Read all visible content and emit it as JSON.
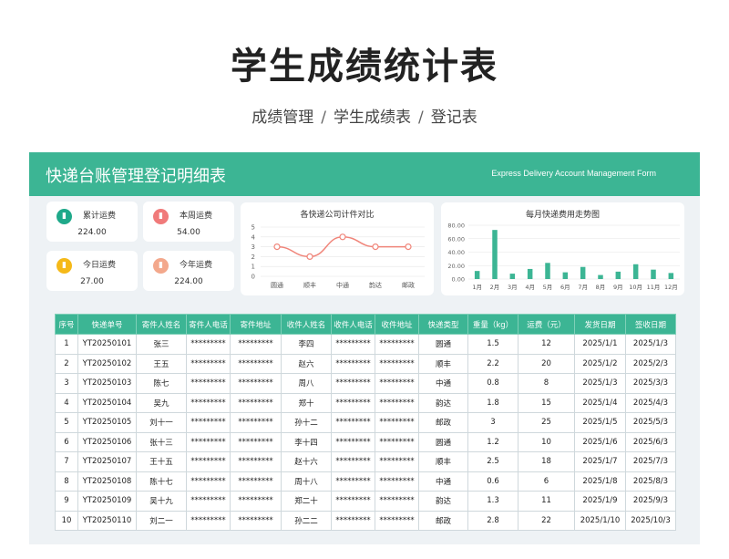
{
  "page": {
    "title": "学生成绩统计表",
    "breadcrumb": [
      "成绩管理",
      "学生成绩表",
      "登记表"
    ],
    "separator": "/"
  },
  "panel": {
    "title": "快递台账管理登记明细表",
    "subtitle": "Express Delivery Account Management Form"
  },
  "stats": [
    {
      "label": "累计运费",
      "value": "224.00",
      "icon": "chart-icon",
      "color": "#1fa98a"
    },
    {
      "label": "本周运费",
      "value": "54.00",
      "icon": "chart-icon",
      "color": "#f07a7a"
    },
    {
      "label": "今日运费",
      "value": "27.00",
      "icon": "chart-icon",
      "color": "#f5b919"
    },
    {
      "label": "今年运费",
      "value": "224.00",
      "icon": "chart-icon",
      "color": "#f3a88c"
    }
  ],
  "chart_data": [
    {
      "type": "line",
      "title": "各快递公司计件对比",
      "categories": [
        "圆通",
        "顺丰",
        "中通",
        "韵达",
        "邮政"
      ],
      "values": [
        3,
        2,
        4,
        3,
        3
      ],
      "ylim": [
        0,
        5
      ],
      "yticks": [
        "0",
        "1",
        "2",
        "3",
        "4",
        "5"
      ],
      "color": "#f0857a"
    },
    {
      "type": "bar",
      "title": "每月快递费用走势图",
      "categories": [
        "1月",
        "2月",
        "3月",
        "4月",
        "5月",
        "6月",
        "7月",
        "8月",
        "9月",
        "10月",
        "11月",
        "12月"
      ],
      "values": [
        12,
        73,
        8,
        15,
        24,
        10,
        18,
        6,
        11,
        22,
        14,
        9
      ],
      "ylim": [
        0,
        80
      ],
      "yticks": [
        "0.00",
        "20.00",
        "40.00",
        "60.00",
        "80.00"
      ],
      "color": "#3cb594"
    }
  ],
  "table": {
    "headers": [
      "序号",
      "快递单号",
      "寄件人姓名",
      "寄件人电话",
      "寄件地址",
      "收件人姓名",
      "收件人电话",
      "收件地址",
      "快递类型",
      "重量（kg）",
      "运费（元）",
      "发货日期",
      "签收日期"
    ],
    "rows": [
      [
        "1",
        "YT20250101",
        "张三",
        "*********",
        "*********",
        "李四",
        "*********",
        "*********",
        "圆通",
        "1.5",
        "12",
        "2025/1/1",
        "2025/1/3"
      ],
      [
        "2",
        "YT20250102",
        "王五",
        "*********",
        "*********",
        "赵六",
        "*********",
        "*********",
        "顺丰",
        "2.2",
        "20",
        "2025/1/2",
        "2025/2/3"
      ],
      [
        "3",
        "YT20250103",
        "陈七",
        "*********",
        "*********",
        "周八",
        "*********",
        "*********",
        "中通",
        "0.8",
        "8",
        "2025/1/3",
        "2025/3/3"
      ],
      [
        "4",
        "YT20250104",
        "吴九",
        "*********",
        "*********",
        "郑十",
        "*********",
        "*********",
        "韵达",
        "1.8",
        "15",
        "2025/1/4",
        "2025/4/3"
      ],
      [
        "5",
        "YT20250105",
        "刘十一",
        "*********",
        "*********",
        "孙十二",
        "*********",
        "*********",
        "邮政",
        "3",
        "25",
        "2025/1/5",
        "2025/5/3"
      ],
      [
        "6",
        "YT20250106",
        "张十三",
        "*********",
        "*********",
        "李十四",
        "*********",
        "*********",
        "圆通",
        "1.2",
        "10",
        "2025/1/6",
        "2025/6/3"
      ],
      [
        "7",
        "YT20250107",
        "王十五",
        "*********",
        "*********",
        "赵十六",
        "*********",
        "*********",
        "顺丰",
        "2.5",
        "18",
        "2025/1/7",
        "2025/7/3"
      ],
      [
        "8",
        "YT20250108",
        "陈十七",
        "*********",
        "*********",
        "周十八",
        "*********",
        "*********",
        "中通",
        "0.6",
        "6",
        "2025/1/8",
        "2025/8/3"
      ],
      [
        "9",
        "YT20250109",
        "吴十九",
        "*********",
        "*********",
        "郑二十",
        "*********",
        "*********",
        "韵达",
        "1.3",
        "11",
        "2025/1/9",
        "2025/9/3"
      ],
      [
        "10",
        "YT20250110",
        "刘二一",
        "*********",
        "*********",
        "孙二二",
        "*********",
        "*********",
        "邮政",
        "2.8",
        "22",
        "2025/1/10",
        "2025/10/3"
      ]
    ]
  }
}
